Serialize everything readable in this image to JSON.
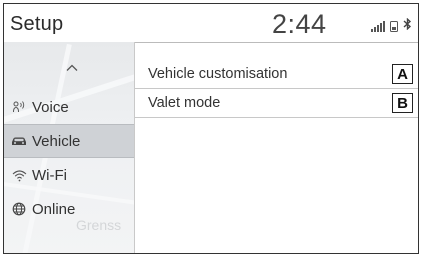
{
  "header": {
    "title": "Setup",
    "clock": "2:44",
    "status_icons": [
      "signal-strength-icon",
      "phone-icon",
      "bluetooth-icon"
    ]
  },
  "sidebar": {
    "scroll_icon": "chevron-up-icon",
    "map_label": "Grenss",
    "items": [
      {
        "label": "Voice",
        "icon": "voice-icon",
        "selected": false
      },
      {
        "label": "Vehicle",
        "icon": "car-icon",
        "selected": true
      },
      {
        "label": "Wi-Fi",
        "icon": "wifi-icon",
        "selected": false
      },
      {
        "label": "Online",
        "icon": "globe-icon",
        "selected": false
      }
    ]
  },
  "main": {
    "rows": [
      {
        "label": "Vehicle customisation",
        "callout": "A"
      },
      {
        "label": "Valet mode",
        "callout": "B"
      }
    ]
  },
  "colors": {
    "sidebar_bg": "#eceef0",
    "selected_bg": "#cfd2d6",
    "divider": "#c8c8c8",
    "text": "#333333"
  }
}
